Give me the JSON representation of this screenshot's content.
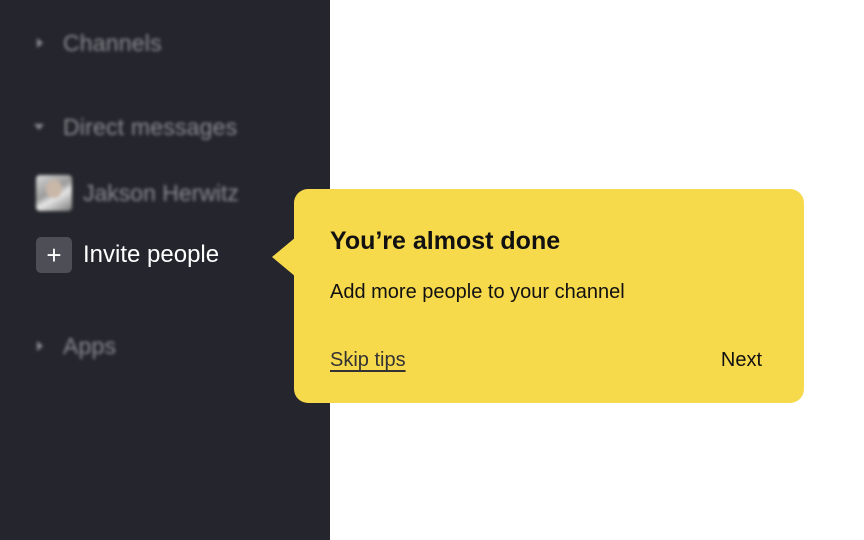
{
  "sidebar": {
    "channels_label": "Channels",
    "direct_messages_label": "Direct messages",
    "dm_items": [
      {
        "name": "Jakson Herwitz"
      }
    ],
    "invite_label": "Invite people",
    "invite_icon": "plus-icon",
    "apps_label": "Apps"
  },
  "tooltip": {
    "title": "You’re almost done",
    "body": "Add more people to your channel",
    "skip_label": "Skip tips",
    "next_label": "Next"
  },
  "colors": {
    "sidebar_bg": "#25262d",
    "tooltip_bg": "#f7d94c",
    "main_bg": "#ffffff"
  }
}
